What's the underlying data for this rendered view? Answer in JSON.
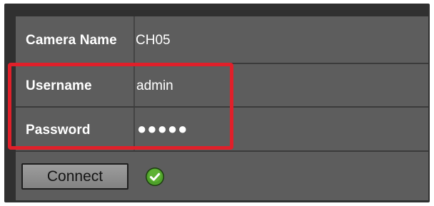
{
  "form": {
    "camera_name_label": "Camera Name",
    "camera_name_value": "CH05",
    "username_label": "Username",
    "username_value": "admin",
    "password_label": "Password",
    "password_value": "●●●●●",
    "connect_label": "Connect"
  },
  "status": {
    "connected_icon": "check-circle-icon",
    "connected_color": "#4ea12a"
  },
  "annotation": {
    "highlight_color": "#e0202a"
  }
}
